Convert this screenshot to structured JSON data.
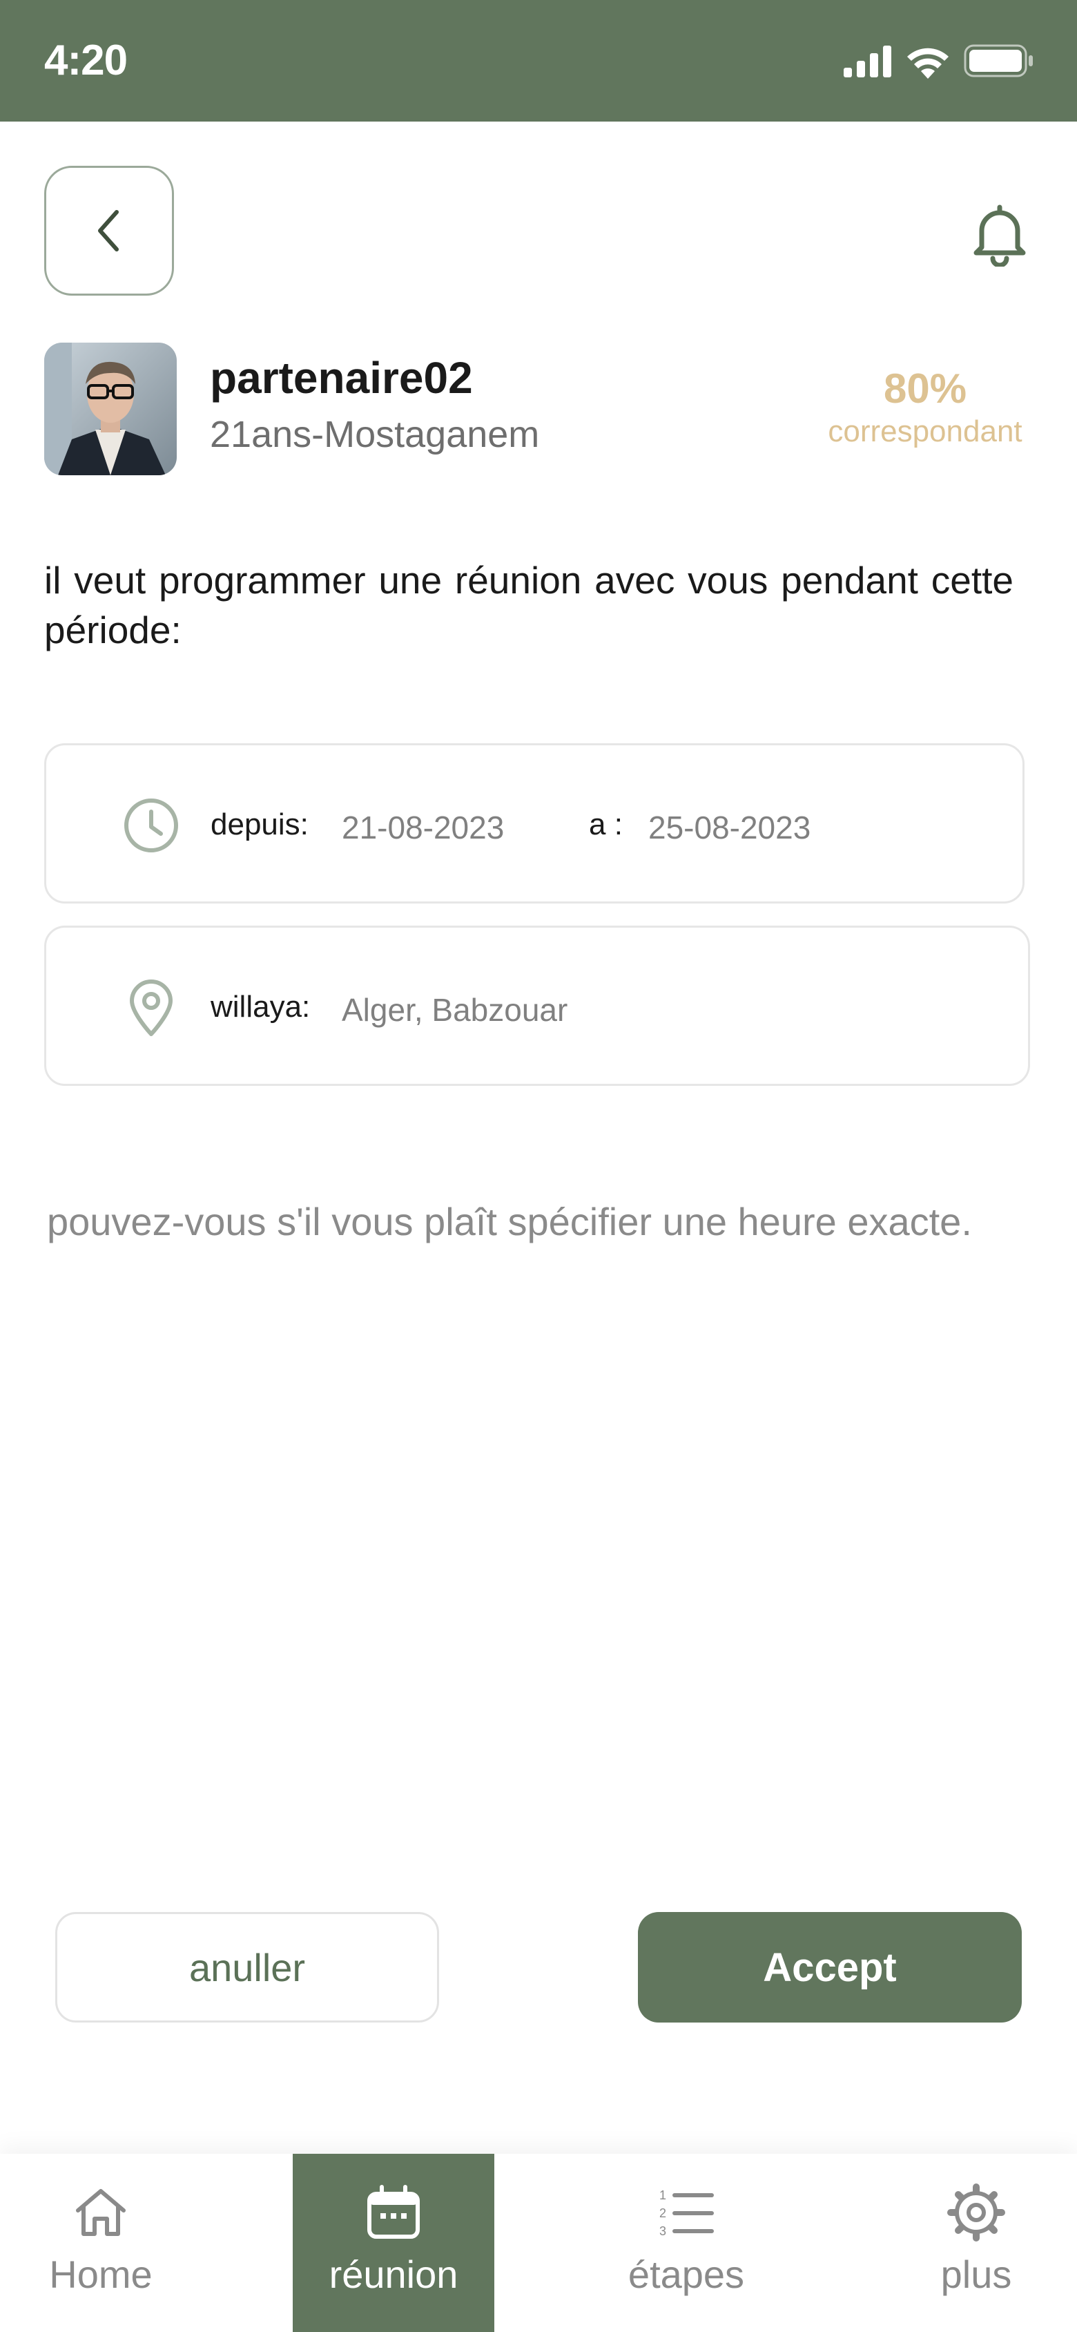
{
  "status_bar": {
    "time": "4:20"
  },
  "profile": {
    "username": "partenaire02",
    "subinfo": "21ans-Mostaganem",
    "match_percent": "80%",
    "match_label": "correspondant"
  },
  "message": "il veut programmer une réunion avec vous pendant cette période:",
  "date_card": {
    "from_label": "depuis:",
    "from_value": "21-08-2023",
    "to_label": "a :",
    "to_value": "25-08-2023"
  },
  "location_card": {
    "label": "willaya:",
    "value": "Alger, Babzouar"
  },
  "question": "pouvez-vous s'il vous plaît spécifier une heure exacte.",
  "actions": {
    "cancel_label": "anuller",
    "accept_label": "Accept"
  },
  "bottom_nav": {
    "items": [
      {
        "label": "Home",
        "icon": "home-icon"
      },
      {
        "label": "réunion",
        "icon": "calendar-icon"
      },
      {
        "label": "étapes",
        "icon": "numbered-list-icon"
      },
      {
        "label": "plus",
        "icon": "gear-icon"
      }
    ],
    "active_index": 1
  },
  "colors": {
    "primary": "#61765d",
    "accent_gold": "#ddc292",
    "muted_text": "#8a8a8a"
  }
}
